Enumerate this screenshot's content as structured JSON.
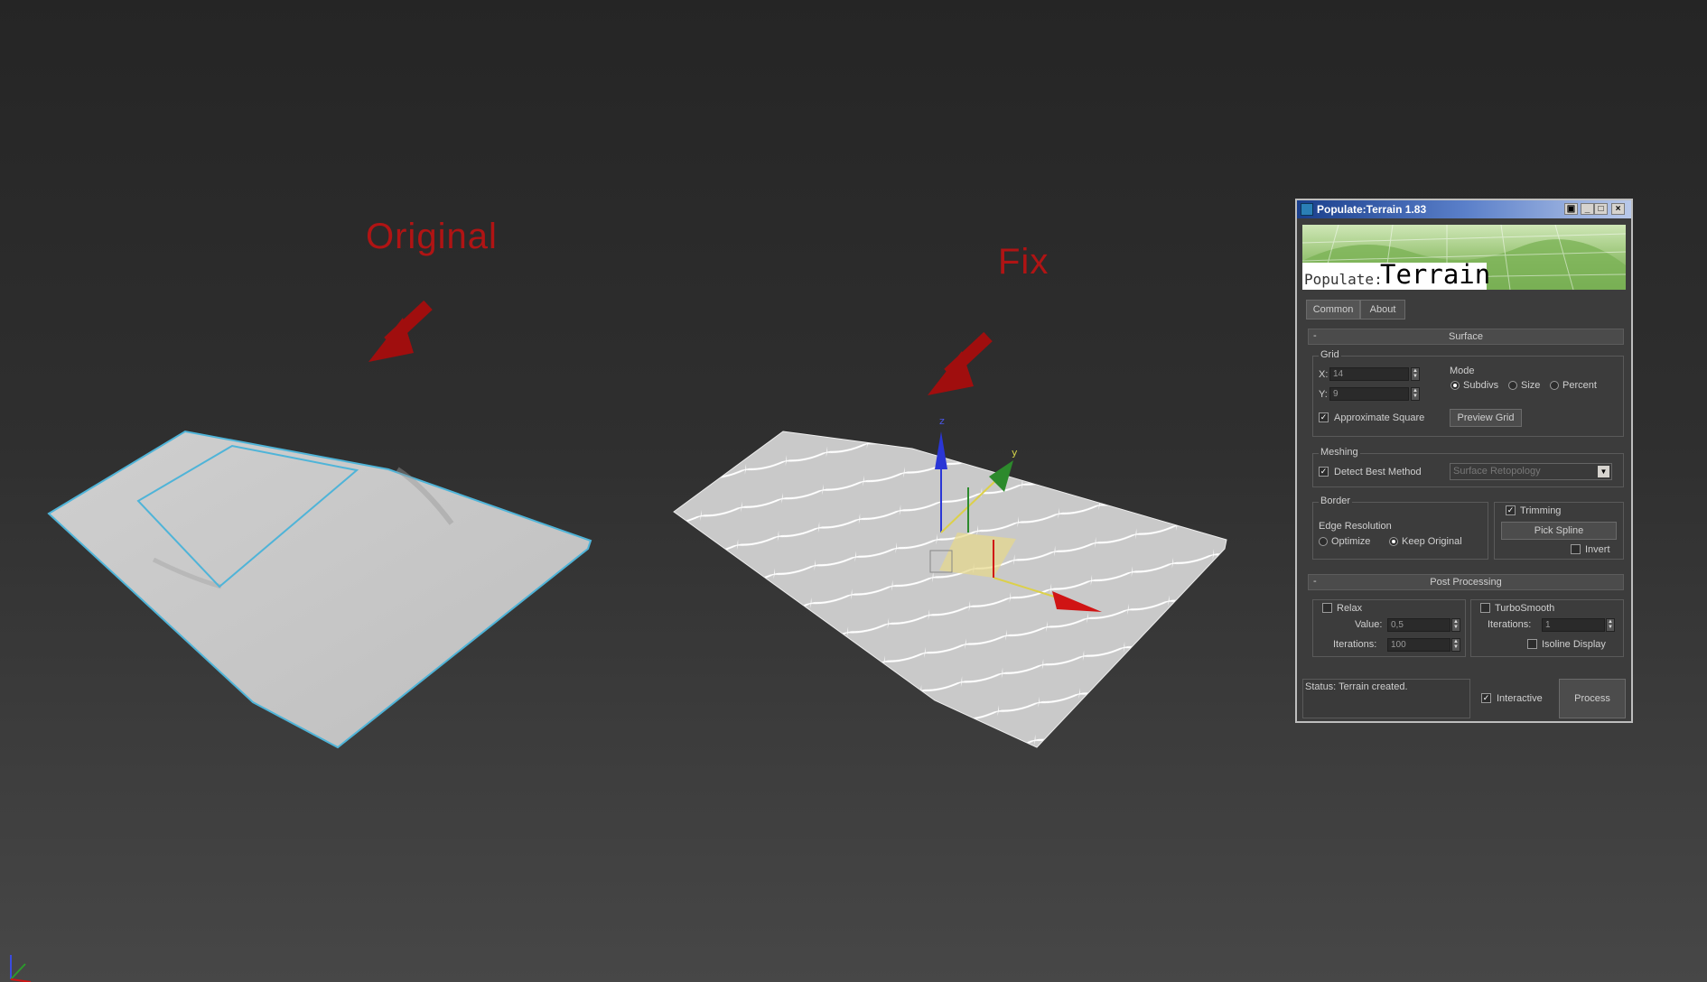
{
  "annotations": {
    "original_label": "Original",
    "fix_label": "Fix",
    "color": "#b01414"
  },
  "viewport": {
    "axis_labels": {
      "z": "z",
      "y": "y"
    },
    "mesh_color": "#c8c8c8",
    "edge_highlight_color": "#4fb4d8"
  },
  "dialog": {
    "title": "Populate:Terrain 1.83",
    "title_buttons": [
      "restore-icon",
      "minimize-icon",
      "maximize-icon",
      "close-icon"
    ],
    "banner": {
      "small_text": "Populate:",
      "big_text": "Terrain"
    },
    "tabs": [
      {
        "label": "Common"
      },
      {
        "label": "About"
      }
    ],
    "surface": {
      "collapse_sign": "-",
      "title": "Surface",
      "grid": {
        "label": "Grid",
        "x_label": "X:",
        "x_value": "14",
        "y_label": "Y:",
        "y_value": "9",
        "approx_square_label": "Approximate Square",
        "approx_square_checked": true,
        "preview_label": "Preview Grid"
      },
      "mode": {
        "label": "Mode",
        "options": [
          "Subdivs",
          "Size",
          "Percent"
        ],
        "selected": "Subdivs"
      },
      "meshing": {
        "label": "Meshing",
        "detect_label": "Detect Best Method",
        "detect_checked": true,
        "method_value": "Surface Retopology"
      },
      "border": {
        "label": "Border",
        "edge_res_label": "Edge Resolution",
        "options": [
          "Optimize",
          "Keep Original"
        ],
        "selected": "Keep Original"
      },
      "trimming": {
        "label": "Trimming",
        "checked": true,
        "pick_label": "Pick Spline",
        "invert_label": "Invert",
        "invert_checked": false
      }
    },
    "post": {
      "collapse_sign": "-",
      "title": "Post Processing",
      "relax": {
        "label": "Relax",
        "checked": false,
        "value_label": "Value:",
        "value": "0,5",
        "iter_label": "Iterations:",
        "iterations": "100"
      },
      "turbosmooth": {
        "label": "TurboSmooth",
        "checked": false,
        "iter_label": "Iterations:",
        "iterations": "1",
        "isoline_label": "Isoline Display",
        "isoline_checked": false
      }
    },
    "status": {
      "text": "Status: Terrain created.",
      "interactive_label": "Interactive",
      "interactive_checked": true,
      "process_label": "Process"
    }
  }
}
